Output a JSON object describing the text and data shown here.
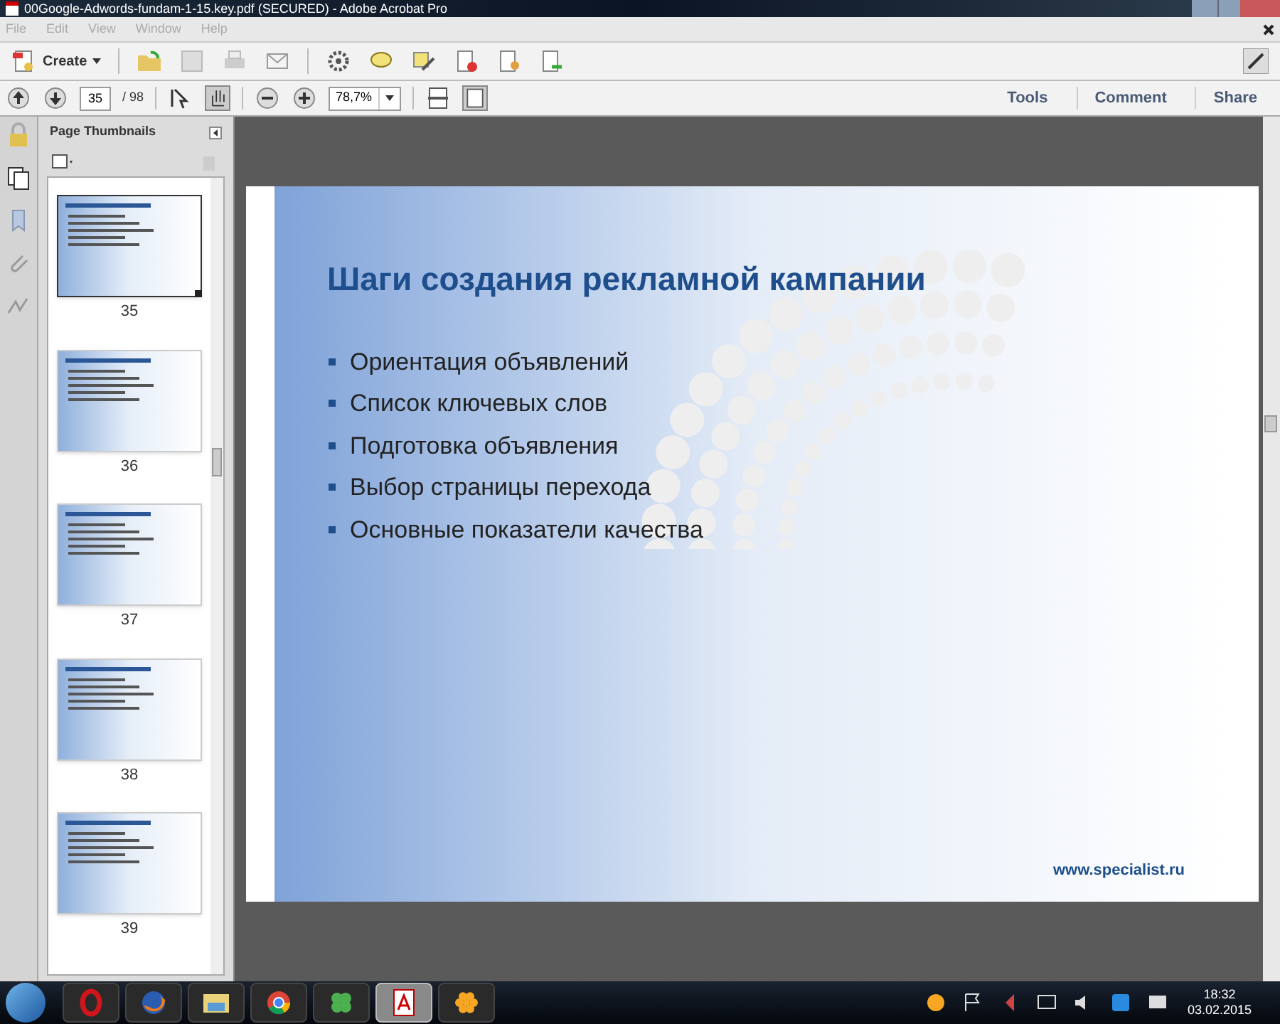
{
  "window": {
    "title": "00Google-Adwords-fundam-1-15.key.pdf (SECURED) - Adobe Acrobat Pro"
  },
  "menu": [
    "File",
    "Edit",
    "View",
    "Window",
    "Help"
  ],
  "toolbar": {
    "create": "Create"
  },
  "navigation": {
    "page": "35",
    "total": "/ 98",
    "zoom": "78,7%"
  },
  "panels": [
    "Tools",
    "Comment",
    "Share"
  ],
  "sidebar": {
    "title": "Page Thumbnails",
    "thumbnails": [
      {
        "page": "35",
        "selected": true
      },
      {
        "page": "36",
        "selected": false
      },
      {
        "page": "37",
        "selected": false
      },
      {
        "page": "38",
        "selected": false
      },
      {
        "page": "39",
        "selected": false
      }
    ]
  },
  "slide": {
    "title": "Шаги создания рекламной кампании",
    "bullets": [
      "Ориентация объявлений",
      "Список ключевых слов",
      "Подготовка объявления",
      "Выбор страницы перехода",
      "Основные показатели качества"
    ],
    "footer": "www.specialist.ru"
  },
  "taskbar": {
    "apps": [
      {
        "kind": "opera",
        "active": false
      },
      {
        "kind": "firefox",
        "active": false
      },
      {
        "kind": "folder",
        "active": false
      },
      {
        "kind": "chrome",
        "active": false
      },
      {
        "kind": "clover",
        "active": false
      },
      {
        "kind": "acrobat",
        "active": true
      },
      {
        "kind": "flower",
        "active": false
      }
    ],
    "time": "18:32",
    "date": "03.02.2015"
  }
}
